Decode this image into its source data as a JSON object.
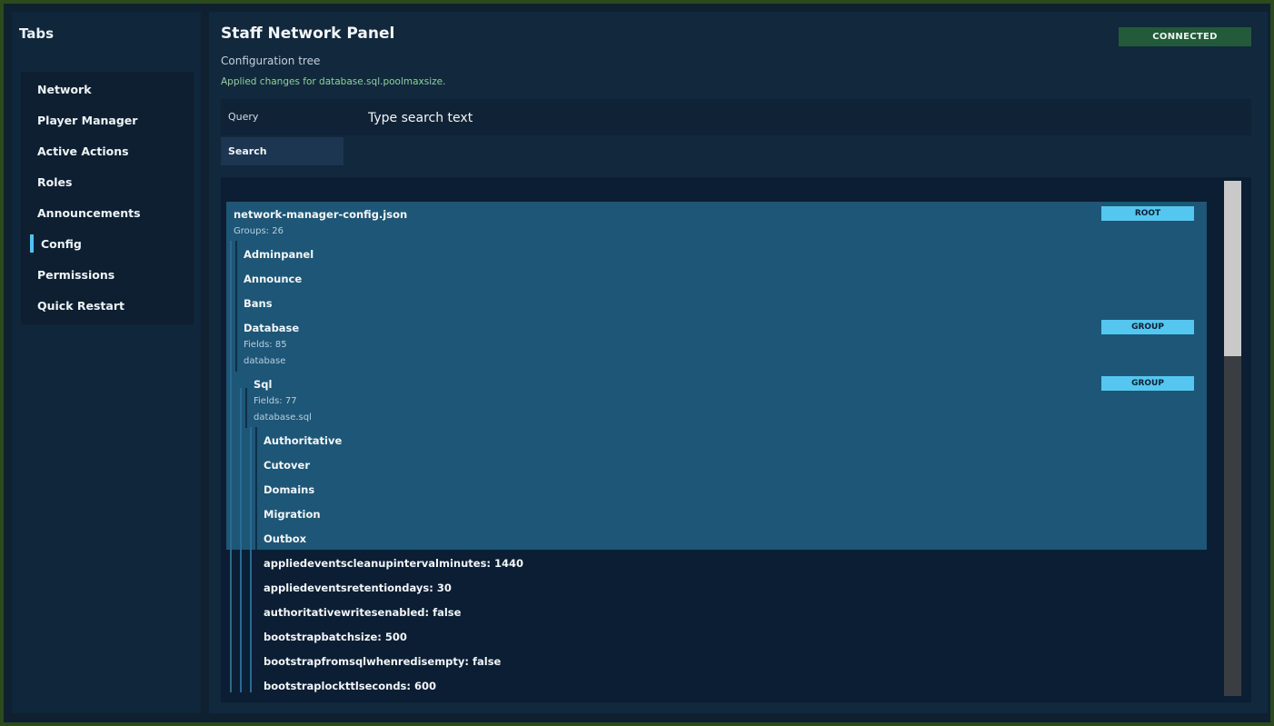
{
  "sidebar": {
    "title": "Tabs",
    "items": [
      {
        "label": "Network"
      },
      {
        "label": "Player Manager"
      },
      {
        "label": "Active Actions"
      },
      {
        "label": "Roles"
      },
      {
        "label": "Announcements"
      },
      {
        "label": "Config",
        "active": true
      },
      {
        "label": "Permissions"
      },
      {
        "label": "Quick Restart"
      }
    ]
  },
  "header": {
    "title": "Staff Network Panel",
    "connection_status": "CONNECTED",
    "subtitle": "Configuration tree",
    "status_message": "Applied changes for database.sql.poolmaxsize."
  },
  "search": {
    "query_label": "Query",
    "placeholder": "Type search text",
    "value": "",
    "button_label": "Search"
  },
  "tree": {
    "root": {
      "name": "network-manager-config.json",
      "badge": "ROOT",
      "groups": "Groups: 26"
    },
    "top_groups": [
      "Adminpanel",
      "Announce",
      "Bans"
    ],
    "database": {
      "name": "Database",
      "badge": "GROUP",
      "fields": "Fields: 85",
      "path": "database"
    },
    "sql": {
      "name": "Sql",
      "badge": "GROUP",
      "fields": "Fields: 77",
      "path": "database.sql"
    },
    "sql_groups": [
      "Authoritative",
      "Cutover",
      "Domains",
      "Migration",
      "Outbox"
    ],
    "fields": [
      "appliedeventscleanupintervalminutes: 1440",
      "appliedeventsretentiondays: 30",
      "authoritativewritesenabled: false",
      "bootstrapbatchsize: 500",
      "bootstrapfromsqlwhenredisempty: false",
      "bootstraplockttlseconds: 600"
    ]
  },
  "colors": {
    "accent": "#4fc3f7",
    "connected": "#235a3a",
    "badge": "#55c6ef",
    "tree_highlight": "#1d5677",
    "status_message": "#8fd19e"
  }
}
